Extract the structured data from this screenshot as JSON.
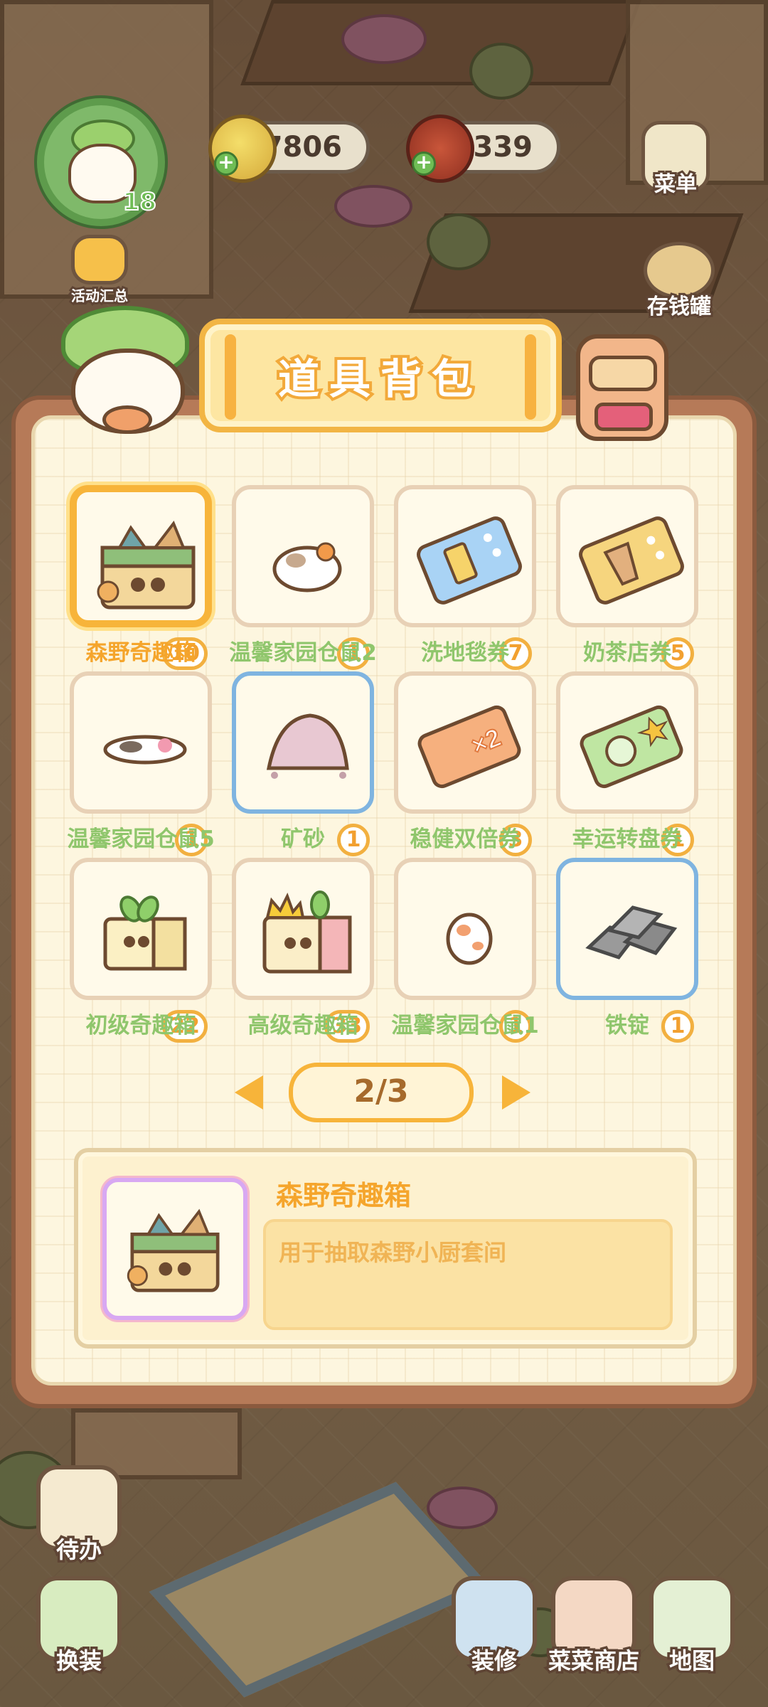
{
  "hud": {
    "level": "18",
    "coins": "7806",
    "food": "2339",
    "menu_label": "菜单",
    "activity_label": "活动汇总",
    "piggybank_label": "存钱罐"
  },
  "panel": {
    "title": "道具背包",
    "items": [
      {
        "name": "森野奇趣箱",
        "count": "10",
        "icon": "forest-gift-box-icon",
        "selected": true
      },
      {
        "name": "温馨家园仓鼠2",
        "count": "1",
        "icon": "hamster-icon"
      },
      {
        "name": "洗地毯券",
        "count": "7",
        "icon": "carpet-wash-ticket-icon"
      },
      {
        "name": "奶茶店券",
        "count": "5",
        "icon": "milk-tea-ticket-icon"
      },
      {
        "name": "温馨家园仓鼠5",
        "count": "1",
        "icon": "hamster-lying-icon"
      },
      {
        "name": "矿砂",
        "count": "1",
        "icon": "ore-sand-icon",
        "border": "blue"
      },
      {
        "name": "稳健双倍券",
        "count": "3",
        "icon": "double-ticket-icon"
      },
      {
        "name": "幸运转盘券",
        "count": "1",
        "icon": "lucky-wheel-ticket-icon"
      },
      {
        "name": "初级奇趣箱",
        "count": "22",
        "icon": "basic-gift-box-icon"
      },
      {
        "name": "高级奇趣箱",
        "count": "33",
        "icon": "premium-gift-box-icon"
      },
      {
        "name": "温馨家园仓鼠1",
        "count": "1",
        "icon": "hamster-sitting-icon"
      },
      {
        "name": "铁锭",
        "count": "1",
        "icon": "iron-ingot-icon",
        "border": "blue"
      }
    ],
    "pager": "2/3",
    "detail": {
      "name": "森野奇趣箱",
      "description": "用于抽取森野小厨套间"
    }
  },
  "bottom": {
    "todo_label": "待办",
    "dress_label": "换装",
    "decorate_label": "装修",
    "shop_label": "菜菜商店",
    "map_label": "地图"
  },
  "colors": {
    "accent_orange": "#f7b43a",
    "item_name_green": "#8fc66c",
    "selected_name": "#f5a52c",
    "panel_frame": "#b67a58"
  }
}
